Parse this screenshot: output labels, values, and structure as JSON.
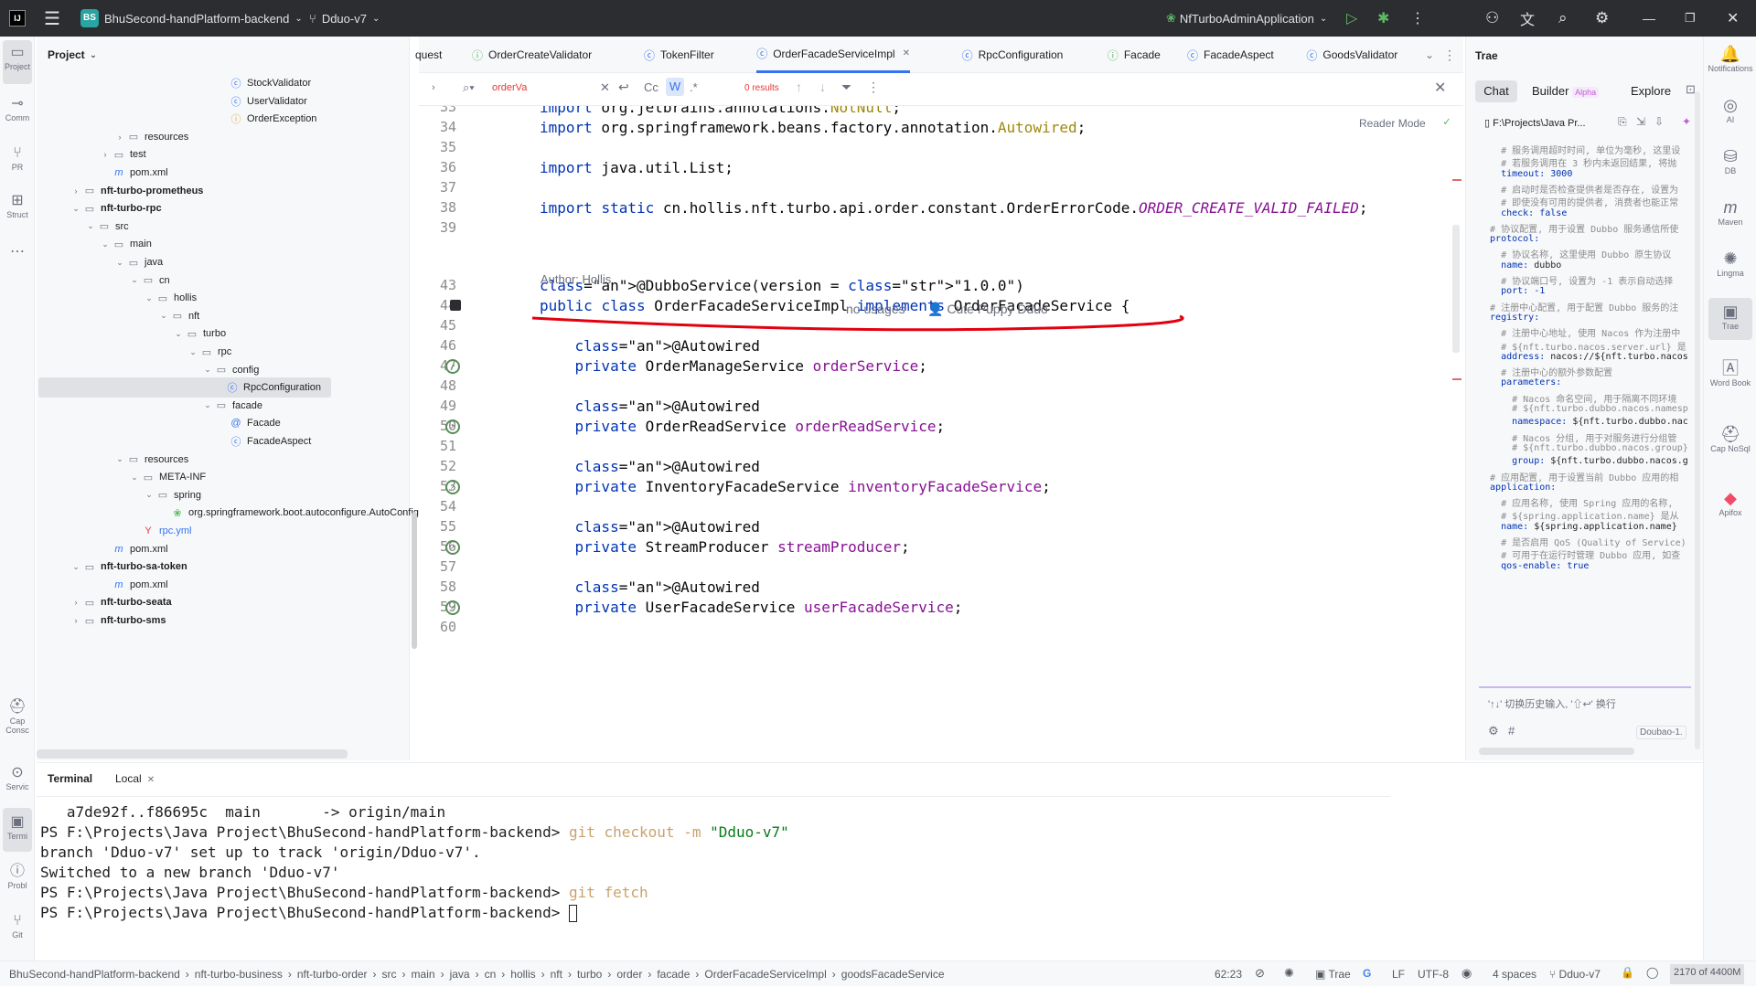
{
  "titlebar": {
    "project_badge": "BS",
    "project_name": "BhuSecond-handPlatform-backend",
    "branch": "Dduo-v7",
    "run_config": "NfTurboAdminApplication"
  },
  "leftstrip": {
    "project": "Project",
    "commit": "Comm",
    "pr": "PR",
    "structure": "Struct",
    "cap": "Cap Consc",
    "services": "Servic",
    "terminal": "Termi",
    "problems": "Probl",
    "git": "Git"
  },
  "project_panel": {
    "title": "Project",
    "rows": [
      {
        "label": "StockValidator",
        "indent": 12,
        "type": "class"
      },
      {
        "label": "UserValidator",
        "indent": 12,
        "type": "class"
      },
      {
        "label": "OrderException",
        "indent": 12,
        "type": "exception"
      },
      {
        "label": "resources",
        "indent": 5,
        "type": "folder",
        "arrow": "›"
      },
      {
        "label": "test",
        "indent": 4,
        "type": "folder",
        "arrow": "›"
      },
      {
        "label": "pom.xml",
        "indent": 4,
        "type": "maven"
      },
      {
        "label": "nft-turbo-prometheus",
        "indent": 2,
        "type": "module",
        "arrow": "›"
      },
      {
        "label": "nft-turbo-rpc",
        "indent": 2,
        "type": "module",
        "arrow": "⌄"
      },
      {
        "label": "src",
        "indent": 3,
        "type": "folder",
        "arrow": "⌄"
      },
      {
        "label": "main",
        "indent": 4,
        "type": "folder",
        "arrow": "⌄"
      },
      {
        "label": "java",
        "indent": 5,
        "type": "folder",
        "arrow": "⌄"
      },
      {
        "label": "cn",
        "indent": 6,
        "type": "folder",
        "arrow": "⌄"
      },
      {
        "label": "hollis",
        "indent": 7,
        "type": "folder",
        "arrow": "⌄"
      },
      {
        "label": "nft",
        "indent": 8,
        "type": "folder",
        "arrow": "⌄"
      },
      {
        "label": "turbo",
        "indent": 9,
        "type": "folder",
        "arrow": "⌄"
      },
      {
        "label": "rpc",
        "indent": 10,
        "type": "folder",
        "arrow": "⌄"
      },
      {
        "label": "config",
        "indent": 11,
        "type": "folder",
        "arrow": "⌄"
      },
      {
        "label": "RpcConfiguration",
        "indent": 12,
        "type": "class",
        "selected": true
      },
      {
        "label": "facade",
        "indent": 11,
        "type": "folder",
        "arrow": "⌄"
      },
      {
        "label": "Facade",
        "indent": 12,
        "type": "annotation"
      },
      {
        "label": "FacadeAspect",
        "indent": 12,
        "type": "class"
      },
      {
        "label": "resources",
        "indent": 5,
        "type": "folder",
        "arrow": "⌄"
      },
      {
        "label": "META-INF",
        "indent": 6,
        "type": "folder",
        "arrow": "⌄"
      },
      {
        "label": "spring",
        "indent": 7,
        "type": "folder",
        "arrow": "⌄"
      },
      {
        "label": "org.springframework.boot.autoconfigure.AutoConfig",
        "indent": 8,
        "type": "spring"
      },
      {
        "label": "rpc.yml",
        "indent": 6,
        "type": "yml"
      },
      {
        "label": "pom.xml",
        "indent": 4,
        "type": "maven"
      },
      {
        "label": "nft-turbo-sa-token",
        "indent": 2,
        "type": "module",
        "arrow": "⌄"
      },
      {
        "label": "pom.xml",
        "indent": 4,
        "type": "maven"
      },
      {
        "label": "nft-turbo-seata",
        "indent": 2,
        "type": "module",
        "arrow": "›"
      },
      {
        "label": "nft-turbo-sms",
        "indent": 2,
        "type": "module",
        "arrow": "›"
      }
    ]
  },
  "tabs": [
    {
      "label": "quest",
      "icon": ""
    },
    {
      "label": "OrderCreateValidator",
      "icon": "green"
    },
    {
      "label": "TokenFilter",
      "icon": "blue"
    },
    {
      "label": "OrderFacadeServiceImpl",
      "icon": "blue",
      "active": true
    },
    {
      "label": "RpcConfiguration",
      "icon": "blue"
    },
    {
      "label": "Facade",
      "icon": "green"
    },
    {
      "label": "FacadeAspect",
      "icon": "blue"
    },
    {
      "label": "GoodsValidator",
      "icon": "blue"
    }
  ],
  "search": {
    "value": "orderVa",
    "results": "0 results",
    "cc": "Cc",
    "w": "W",
    "regex": ".*"
  },
  "editor": {
    "reader_mode": "Reader Mode",
    "author_hint": "Author: Hollis",
    "no_usages": "no usages",
    "author_inlay": "Cute Puppy Dduo",
    "lines": [
      {
        "n": "33",
        "t": "import org.jetbrains.annotations.NotNull;"
      },
      {
        "n": "34",
        "t": "import org.springframework.beans.factory.annotation.Autowired;"
      },
      {
        "n": "35",
        "t": ""
      },
      {
        "n": "36",
        "t": "import java.util.List;"
      },
      {
        "n": "37",
        "t": ""
      },
      {
        "n": "38",
        "t": "import static cn.hollis.nft.turbo.api.order.constant.OrderErrorCode.ORDER_CREATE_VALID_FAILED;"
      },
      {
        "n": "39",
        "t": ""
      },
      {
        "n": "43",
        "t": "@DubboService(version = \"1.0.0\")"
      },
      {
        "n": "44",
        "t": "public class OrderFacadeServiceImpl implements OrderFacadeService {"
      },
      {
        "n": "45",
        "t": ""
      },
      {
        "n": "46",
        "t": "    @Autowired"
      },
      {
        "n": "47",
        "t": "    private OrderManageService orderService;"
      },
      {
        "n": "48",
        "t": ""
      },
      {
        "n": "49",
        "t": "    @Autowired"
      },
      {
        "n": "50",
        "t": "    private OrderReadService orderReadService;"
      },
      {
        "n": "51",
        "t": ""
      },
      {
        "n": "52",
        "t": "    @Autowired"
      },
      {
        "n": "53",
        "t": "    private InventoryFacadeService inventoryFacadeService;"
      },
      {
        "n": "54",
        "t": ""
      },
      {
        "n": "55",
        "t": "    @Autowired"
      },
      {
        "n": "56",
        "t": "    private StreamProducer streamProducer;"
      },
      {
        "n": "57",
        "t": ""
      },
      {
        "n": "58",
        "t": "    @Autowired"
      },
      {
        "n": "59",
        "t": "    private UserFacadeService userFacadeService;"
      },
      {
        "n": "60",
        "t": ""
      }
    ]
  },
  "trae": {
    "title": "Trae",
    "tab_chat": "Chat",
    "tab_builder": "Builder",
    "alpha": "Alpha",
    "tab_explore": "Explore",
    "path": "F:\\Projects\\Java Pr...",
    "input_hint": "'↑↓' 切换历史输入, '⇧↩' 换行",
    "model": "Doubao-1.",
    "yaml": [
      {
        "c": "yc",
        "t": "    # 服务调用超时时间, 单位为毫秒, 这里设"
      },
      {
        "c": "yc",
        "t": "    # 若服务调用在 3 秒内未返回结果, 将抛"
      },
      {
        "c": "yk",
        "t": "    timeout: 3000"
      },
      {
        "c": "yc",
        "t": "    # 启动时是否检查提供者是否存在, 设置为"
      },
      {
        "c": "yc",
        "t": "    # 即使没有可用的提供者, 消费者也能正常"
      },
      {
        "c": "yk",
        "t": "    check: false"
      },
      {
        "c": "yc",
        "t": "  # 协议配置, 用于设置 Dubbo 服务通信所使"
      },
      {
        "c": "yk",
        "t": "  protocol:"
      },
      {
        "c": "yc",
        "t": "    # 协议名称, 这里使用 Dubbo 原生协议"
      },
      {
        "c": "yk",
        "t": "    name: dubbo"
      },
      {
        "c": "yc",
        "t": "    # 协议端口号, 设置为 -1 表示自动选择"
      },
      {
        "c": "yk",
        "t": "    port: -1"
      },
      {
        "c": "yc",
        "t": "  # 注册中心配置, 用于配置 Dubbo 服务的注"
      },
      {
        "c": "yk",
        "t": "  registry:"
      },
      {
        "c": "yc",
        "t": "    # 注册中心地址, 使用 Nacos 作为注册中"
      },
      {
        "c": "yc",
        "t": "    # ${nft.turbo.nacos.server.url} 是"
      },
      {
        "c": "yk",
        "t": "    address: nacos://${nft.turbo.nacos"
      },
      {
        "c": "yc",
        "t": "    # 注册中心的额外参数配置"
      },
      {
        "c": "yk",
        "t": "    parameters:"
      },
      {
        "c": "yc",
        "t": "      # Nacos 命名空间, 用于隔离不同环境"
      },
      {
        "c": "yc",
        "t": "      # ${nft.turbo.dubbo.nacos.namesp"
      },
      {
        "c": "yk",
        "t": "      namespace: ${nft.turbo.dubbo.nac"
      },
      {
        "c": "yc",
        "t": "      # Nacos 分组, 用于对服务进行分组管"
      },
      {
        "c": "yc",
        "t": "      # ${nft.turbo.dubbo.nacos.group}"
      },
      {
        "c": "yk",
        "t": "      group: ${nft.turbo.dubbo.nacos.g"
      },
      {
        "c": "yc",
        "t": "  # 应用配置, 用于设置当前 Dubbo 应用的相"
      },
      {
        "c": "yk",
        "t": "  application:"
      },
      {
        "c": "yc",
        "t": "    # 应用名称, 使用 Spring 应用的名称,"
      },
      {
        "c": "yc",
        "t": "    # ${spring.application.name} 是从"
      },
      {
        "c": "yk",
        "t": "    name: ${spring.application.name}"
      },
      {
        "c": "yc",
        "t": "    # 是否启用 QoS (Quality of Service)"
      },
      {
        "c": "yc",
        "t": "    # 可用于在运行时管理 Dubbo 应用, 如查"
      },
      {
        "c": "yk",
        "t": "    qos-enable: true"
      }
    ]
  },
  "rightstrip": {
    "notifications": "Notifications",
    "ai": "AI",
    "db": "DB",
    "maven": "Maven",
    "lingma": "Lingma",
    "trae": "Trae",
    "wordbook": "Word Book",
    "capnosql": "Cap NoSql",
    "apifox": "Apifox"
  },
  "terminal": {
    "tab_terminal": "Terminal",
    "tab_local": "Local",
    "lines": [
      {
        "p": "   a7de92f..f86695c  main       -> origin/main",
        "cmd": "",
        "arg": ""
      },
      {
        "p": "PS F:\\Projects\\Java Project\\BhuSecond-handPlatform-backend> ",
        "cmd": "git checkout -m ",
        "arg": "\"Dduo-v7\""
      },
      {
        "p": "branch 'Dduo-v7' set up to track 'origin/Dduo-v7'.",
        "cmd": "",
        "arg": ""
      },
      {
        "p": "Switched to a new branch 'Dduo-v7'",
        "cmd": "",
        "arg": ""
      },
      {
        "p": "PS F:\\Projects\\Java Project\\BhuSecond-handPlatform-backend> ",
        "cmd": "git fetch",
        "arg": ""
      },
      {
        "p": "PS F:\\Projects\\Java Project\\BhuSecond-handPlatform-backend> ",
        "cmd": "",
        "arg": ""
      }
    ]
  },
  "statusbar": {
    "crumbs": [
      "BhuSecond-handPlatform-backend",
      "nft-turbo-business",
      "nft-turbo-order",
      "src",
      "main",
      "java",
      "cn",
      "hollis",
      "nft",
      "turbo",
      "order",
      "facade",
      "OrderFacadeServiceImpl",
      "goodsFacadeService"
    ],
    "position": "62:23",
    "trae": "Trae",
    "lf": "LF",
    "enc": "UTF-8",
    "indent": "4 spaces",
    "branch": "Dduo-v7",
    "memory": "2170 of 4400M"
  }
}
